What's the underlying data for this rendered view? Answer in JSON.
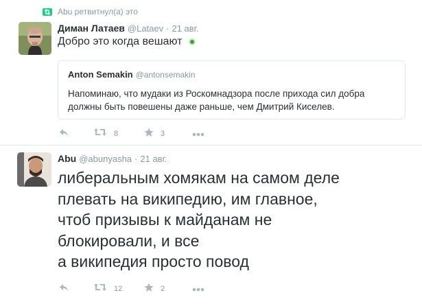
{
  "tweets": [
    {
      "retweet_text": "Abu ретвитнул(а) это",
      "fullname": "Диман Латаев",
      "username": "@Lataev",
      "time": "21 авг.",
      "text": "Добро это когда вешают",
      "quote": {
        "fullname": "Anton Semakin",
        "username": "@antonsemakin",
        "text": "Напоминаю, что мудаки из Роскомнадзора после прихода сил добра должны быть повешены даже раньше, чем Дмитрий Киселев."
      },
      "retweets": "8",
      "favorites": "3"
    },
    {
      "fullname": "Abu",
      "username": "@abunyasha",
      "time": "21 авг.",
      "text_lines": [
        "либеральным хомякам на самом деле",
        "плевать на википедию, им главное,",
        "чтоб призывы к майданам не",
        "блокировали, и все",
        "а википедия просто повод"
      ],
      "retweets": "12",
      "favorites": "2"
    }
  ],
  "separator": "·",
  "colors": {
    "text": "#292f33",
    "muted": "#8899a6",
    "icon": "#aab8c2",
    "retweet_green": "#19cf86",
    "border": "#e1e8ed"
  },
  "icons": [
    "retweeted-icon",
    "reply-icon",
    "retweet-icon",
    "favorite-icon",
    "more-icon"
  ]
}
